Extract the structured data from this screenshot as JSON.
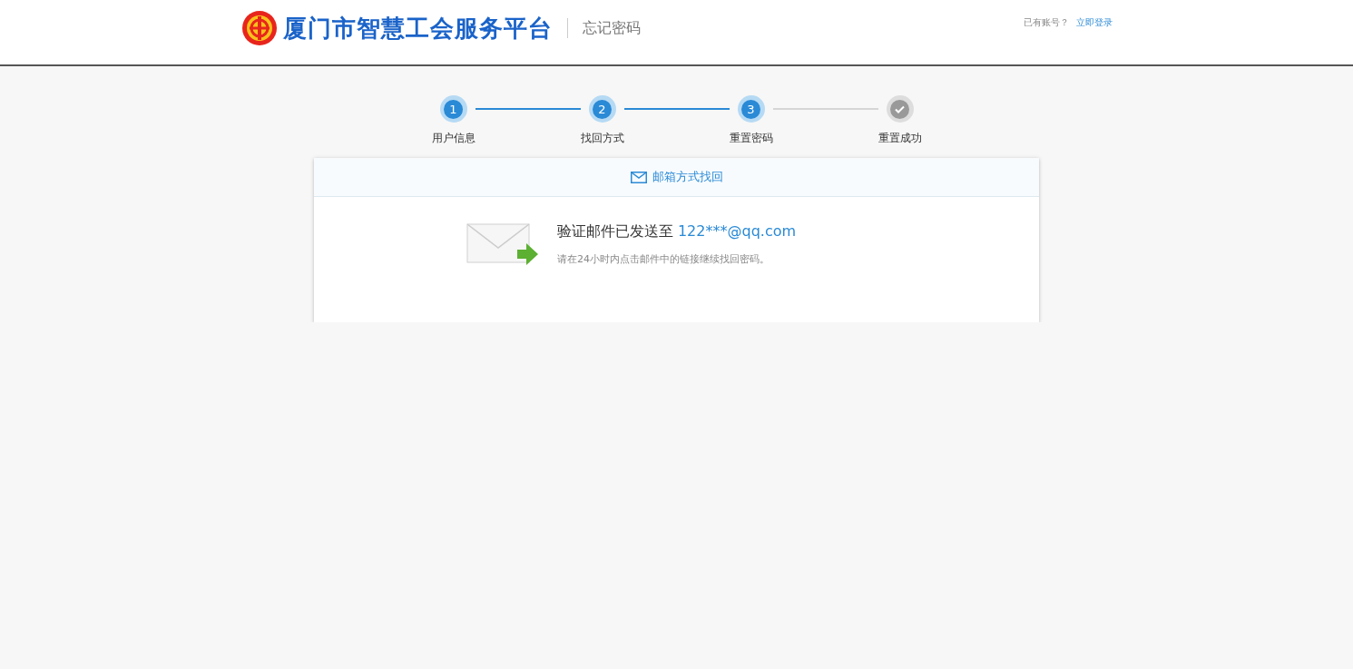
{
  "header": {
    "brand": "厦门市智慧工会服务平台",
    "page_title": "忘记密码",
    "account_prompt": "已有账号？",
    "login_link": "立即登录"
  },
  "steps": [
    {
      "number": "1",
      "label": "用户信息",
      "done": true
    },
    {
      "number": "2",
      "label": "找回方式",
      "done": true
    },
    {
      "number": "3",
      "label": "重置密码",
      "done": true
    },
    {
      "label": "重置成功",
      "done": false
    }
  ],
  "card": {
    "tab": "邮箱方式找回",
    "heading": "验证邮件已发送至",
    "email": "122***@qq.com",
    "hint": "请在24小时内点击邮件中的链接继续找回密码。"
  }
}
